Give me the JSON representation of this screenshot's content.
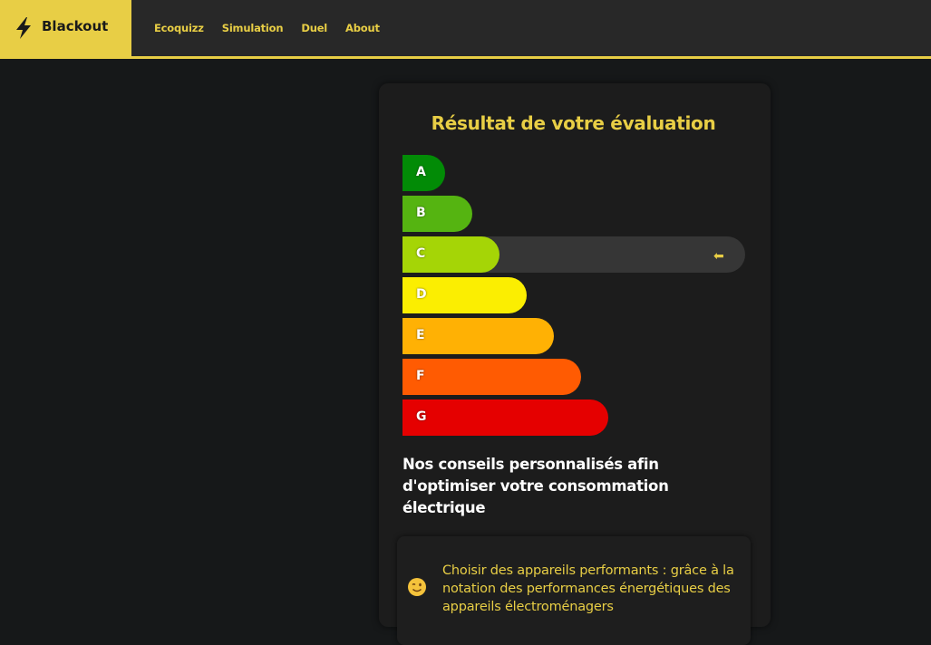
{
  "navbar": {
    "brand": "Blackout",
    "links": [
      "Ecoquizz",
      "Simulation",
      "Duel",
      "About"
    ],
    "accent_color": "#e8ce45"
  },
  "result": {
    "title": "Résultat de votre évaluation",
    "selected_grade": "C",
    "grades": [
      {
        "letter": "A",
        "color": "#028b06"
      },
      {
        "letter": "B",
        "color": "#55b411"
      },
      {
        "letter": "C",
        "color": "#a5d506"
      },
      {
        "letter": "D",
        "color": "#fbee01"
      },
      {
        "letter": "E",
        "color": "#ffb104"
      },
      {
        "letter": "F",
        "color": "#ff5b02"
      },
      {
        "letter": "G",
        "color": "#e50000"
      }
    ],
    "indicator_icon": "left-arrow-icon"
  },
  "tips": {
    "heading": "Nos conseils personnalisés afin d'optimiser votre consommation électrique",
    "items": [
      {
        "icon": "winking-face-icon",
        "text": "Choisir des appareils performants : grâce à la notation des performances énergétiques des appareils électroménagers"
      }
    ]
  }
}
